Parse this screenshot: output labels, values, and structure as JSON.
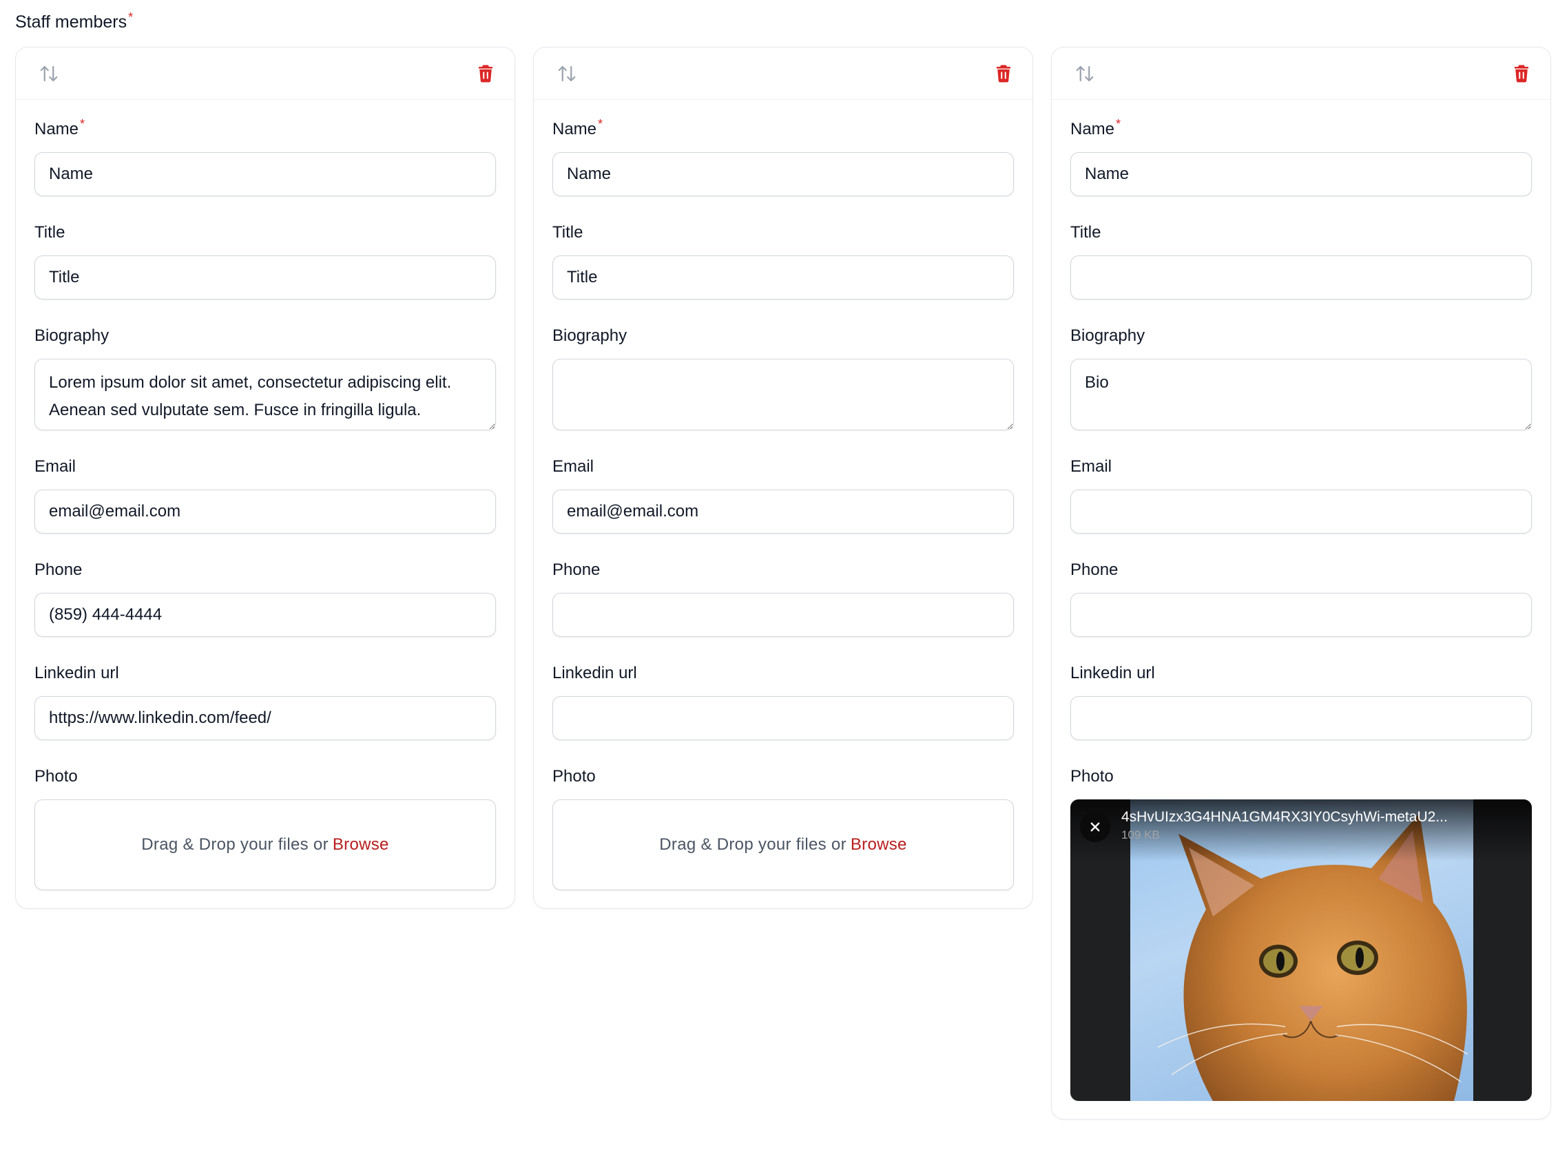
{
  "section": {
    "label": "Staff members",
    "required_mark": "*"
  },
  "labels": {
    "name": "Name",
    "required_mark": "*",
    "title": "Title",
    "biography": "Biography",
    "email": "Email",
    "phone": "Phone",
    "linkedin": "Linkedin url",
    "photo": "Photo"
  },
  "dropzone": {
    "text": "Drag & Drop your files or",
    "browse": "Browse"
  },
  "colors": {
    "accent": "#b91c1c",
    "danger": "#dc2626",
    "border": "#d1d5db"
  },
  "icons": {
    "reorder": "arrows-up-down-icon",
    "delete": "trash-icon",
    "remove_file": "close-icon"
  },
  "members": [
    {
      "name": {
        "value": "",
        "placeholder": "Name"
      },
      "title": {
        "value": "",
        "placeholder": "Title"
      },
      "biography": {
        "value": "Lorem ipsum dolor sit amet, consectetur adipiscing elit. Aenean sed vulputate sem. Fusce in fringilla ligula. Vivamus in massa a sapien tempus consequat at in odio.",
        "placeholder": ""
      },
      "email": {
        "value": "email@email.com",
        "placeholder": ""
      },
      "phone": {
        "value": "(859) 444-4444",
        "placeholder": ""
      },
      "linkedin": {
        "value": "https://www.linkedin.com/feed/",
        "placeholder": ""
      }
    },
    {
      "name": {
        "value": "",
        "placeholder": "Name"
      },
      "title": {
        "value": "",
        "placeholder": "Title"
      },
      "biography": {
        "value": "",
        "placeholder": ""
      },
      "email": {
        "value": "email@email.com",
        "placeholder": ""
      },
      "phone": {
        "value": "",
        "placeholder": ""
      },
      "linkedin": {
        "value": "",
        "placeholder": ""
      }
    },
    {
      "name": {
        "value": "",
        "placeholder": "Name"
      },
      "title": {
        "value": "",
        "placeholder": ""
      },
      "biography": {
        "value": "",
        "placeholder": "Bio"
      },
      "email": {
        "value": "",
        "placeholder": ""
      },
      "phone": {
        "value": "",
        "placeholder": ""
      },
      "linkedin": {
        "value": "",
        "placeholder": ""
      },
      "photo": {
        "filename": "4sHvUIzx3G4HNA1GM4RX3IY0CsyhWi-metaU2...",
        "size": "109 KB"
      }
    }
  ]
}
